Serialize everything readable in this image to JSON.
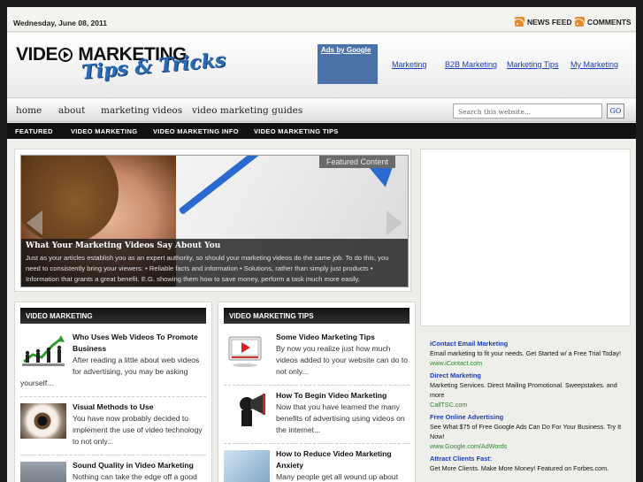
{
  "topbar": {
    "date": "Wednesday, June 08, 2011",
    "news_feed": "NEWS FEED",
    "comments": "COMMENTS"
  },
  "header": {
    "logo_main_left": "VIDE",
    "logo_main_right": "MARKETING",
    "logo_sub": "Tips & Tricks",
    "ads_label": "Ads by Google",
    "ad_links": [
      "Marketing",
      "B2B Marketing",
      "Marketing Tips",
      "My Marketing"
    ]
  },
  "nav": {
    "items": [
      "home",
      "about",
      "marketing videos",
      "video marketing guides"
    ],
    "search_placeholder": "Search this website...",
    "go_label": "GO"
  },
  "categories": [
    "FEATURED",
    "VIDEO MARKETING",
    "VIDEO MARKETING INFO",
    "VIDEO MARKETING TIPS"
  ],
  "slider": {
    "badge": "Featured Content",
    "title": "What Your Marketing Videos Say About You",
    "body": "Just as your articles establish you as an expert authority, so should your marketing videos do the same job. To do this, you need to consistently bring your viewers: • Reliable facts and information • Solutions, rather than simply just products • Information that grants a great benefit. E.G. showing them how to save money, perform a task much more easily,"
  },
  "col_left": {
    "heading": "VIDEO MARKETING",
    "posts": [
      {
        "title": "Who Uses Web Videos To Promote Business",
        "body": "After reading a little about web videos for advertising, you may be asking yourself..."
      },
      {
        "title": "Visual Methods to Use",
        "body": "You have now probably decided to implement the use of video technology to not only..."
      },
      {
        "title": "Sound Quality in Video Marketing",
        "body": "Nothing can take the edge off a good"
      }
    ]
  },
  "col_right": {
    "heading": "VIDEO MARKETING TIPS",
    "posts": [
      {
        "title": "Some Video Marketing Tips",
        "body": "By now you realize just how much videos added to your website can do to not only..."
      },
      {
        "title": "How To Begin Video Marketing",
        "body": "Now that you have learned the many benefits of advertising using videos on the internet..."
      },
      {
        "title": "How to Reduce Video Marketing Anxiety",
        "body": "Many people get all wound up about"
      }
    ]
  },
  "sidebar_ads": [
    {
      "title": "iContact Email Marketing",
      "body": "Email marketing to fit your needs. Get Started w/ a Free Trial Today!",
      "url": "www.iContact.com"
    },
    {
      "title": "Direct Marketing",
      "body": "Marketing Services. Direct Mailing Promotional. Sweepstakes. and more",
      "url": "CallTSC.com"
    },
    {
      "title": "Free Online Advertising",
      "body": "See What $75 of Free Google Ads Can Do For Your Business. Try It Now!",
      "url": "www.Google.com/AdWords"
    },
    {
      "title": "Attract Clients Fast:",
      "body": "Get More Clients. Make More Money! Featured on Forbes.com.",
      "url": ""
    }
  ],
  "colors": {
    "ad_link": "#1a3fb5",
    "ad_url": "#2a8a2a",
    "logo_blue": "#2a6bb8",
    "rss_orange": "#e9892d"
  }
}
